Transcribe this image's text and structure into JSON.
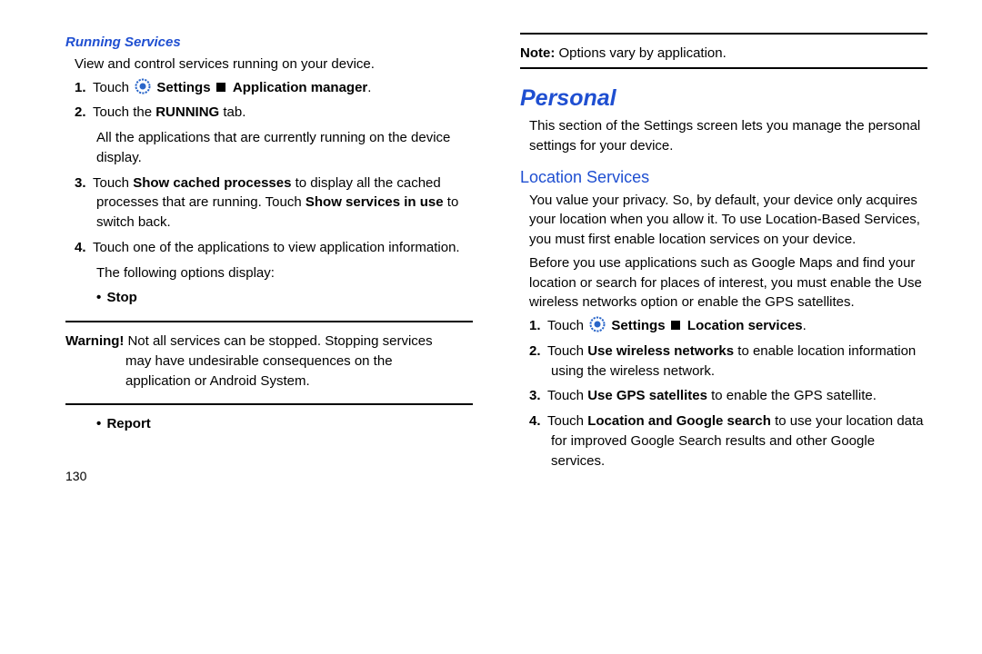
{
  "left": {
    "running_services": "Running Services",
    "view_control": "View and control services running on your device.",
    "steps": {
      "n1": "1.",
      "s1a": "Touch ",
      "s1b": "Settings",
      "s1c": "Application manager",
      "n2": "2.",
      "s2a": "Touch the ",
      "s2b": "RUNNING",
      "s2c": " tab.",
      "s2_follow": "All the applications that are currently running on the device display.",
      "n3": "3.",
      "s3a": "Touch ",
      "s3b": "Show cached processes",
      "s3c": " to display all the cached processes that are running. Touch ",
      "s3d": "Show services in use",
      "s3e": " to switch back.",
      "n4": "4.",
      "s4a": "Touch one of the applications to view application information.",
      "s4_follow": "The following options display:",
      "bullet_stop": "Stop"
    },
    "warning_label": "Warning!",
    "warning_line1": "Not all services can be stopped. Stopping services",
    "warning_line2": "may have undesirable consequences on the",
    "warning_line3": "application or Android System.",
    "bullet_report": "Report",
    "page_num": "130"
  },
  "right": {
    "note_label": "Note:",
    "note_text": " Options vary by application.",
    "personal": "Personal",
    "personal_body": "This section of the Settings screen lets you manage the personal settings for your device.",
    "location_services": "Location Services",
    "loc_body1": "You value your privacy. So, by default, your device only acquires your location when you allow it. To use Location-Based Services, you must first enable location services on your device.",
    "loc_body2": "Before you use applications such as Google Maps and find your location or search for places of interest, you must enable the Use wireless networks option or enable the GPS satellites.",
    "steps": {
      "n1": "1.",
      "s1a": "Touch ",
      "s1b": "Settings",
      "s1c": "Location services",
      "n2": "2.",
      "s2a": "Touch ",
      "s2b": "Use wireless networks",
      "s2c": " to enable location information using the wireless network.",
      "n3": "3.",
      "s3a": "Touch ",
      "s3b": "Use GPS satellites",
      "s3c": " to enable the GPS satellite.",
      "n4": "4.",
      "s4a": "Touch ",
      "s4b": "Location and Google search",
      "s4c": " to use your location data for improved Google Search results and other Google services."
    }
  }
}
